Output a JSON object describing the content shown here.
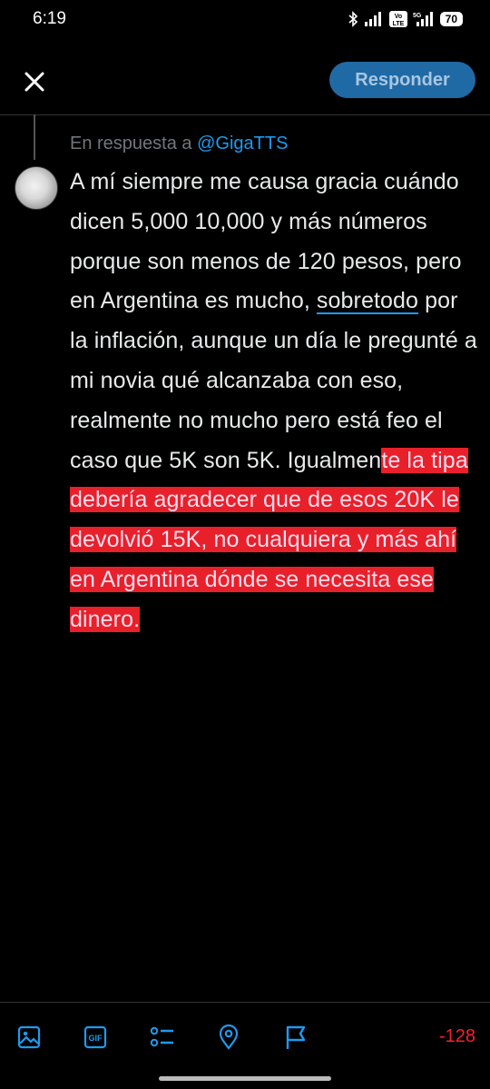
{
  "status_bar": {
    "time": "6:19",
    "battery": "70"
  },
  "header": {
    "reply_button": "Responder"
  },
  "reply_context": {
    "prefix": "En respuesta a",
    "handle": "@GigaTTS"
  },
  "tweet": {
    "text_part1": "A mí siempre me causa gracia cuándo dicen 5,000 10,000 y más números porque son menos de 120 pesos, pero en Argentina es mucho, ",
    "underlined_word": "sobretodo",
    "text_part2": " por la inflación, aunque un día le pregunté a mi novia qué alcanzaba con eso, realmente no mucho pero está feo el caso que 5K son 5K. Igualmen",
    "highlighted_text": "te la tipa debería agradecer que de esos 20K le devolvió 15K, no cualquiera y más ahí en Argentina dónde se necesita ese dinero."
  },
  "toolbar": {
    "icons": [
      "image-icon",
      "gif-icon",
      "poll-icon",
      "location-icon",
      "flag-icon"
    ],
    "char_counter": "-128"
  },
  "colors": {
    "accent": "#1d9bf0",
    "highlight": "#e8202a",
    "counter": "#f4212e"
  }
}
